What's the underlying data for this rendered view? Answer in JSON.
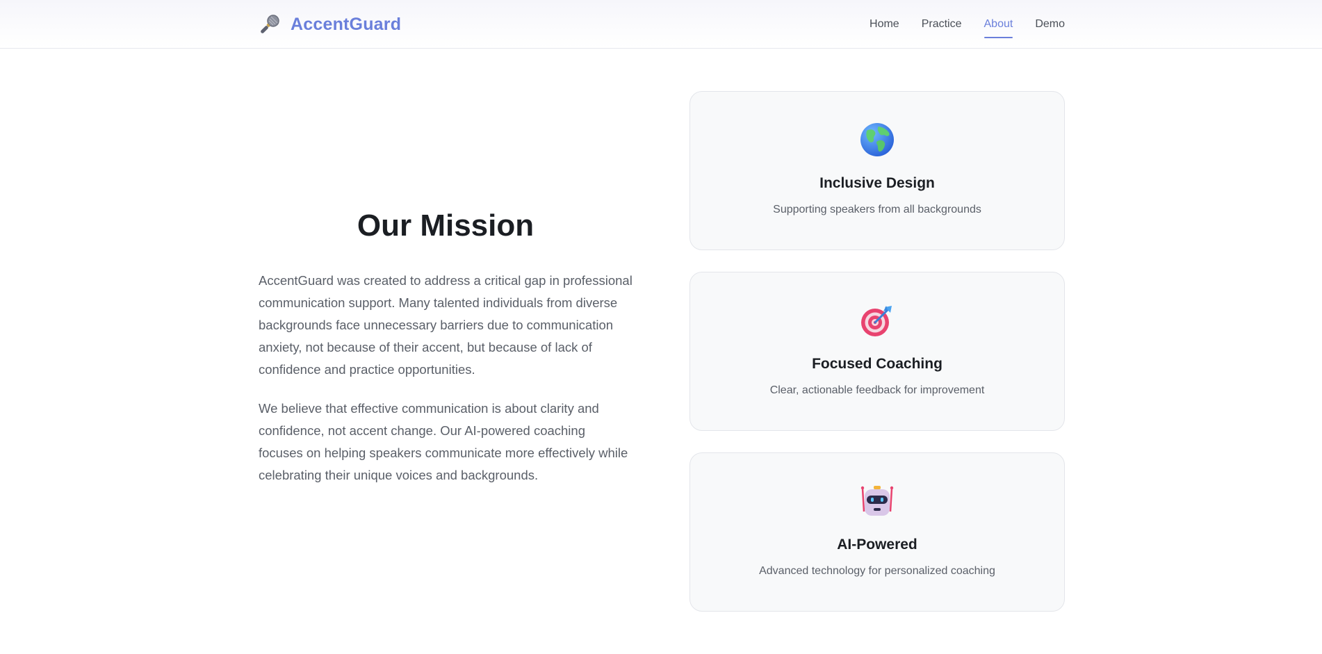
{
  "brand": {
    "name": "AccentGuard",
    "icon": "microphone-icon"
  },
  "nav": {
    "items": [
      {
        "label": "Home",
        "active": false
      },
      {
        "label": "Practice",
        "active": false
      },
      {
        "label": "About",
        "active": true
      },
      {
        "label": "Demo",
        "active": false
      }
    ]
  },
  "mission": {
    "title": "Our Mission",
    "paragraphs": [
      "AccentGuard was created to address a critical gap in professional communication support. Many talented individuals from diverse backgrounds face unnecessary barriers due to communication anxiety, not because of their accent, but because of lack of confidence and practice opportunities.",
      "We believe that effective communication is about clarity and confidence, not accent change. Our AI-powered coaching focuses on helping speakers communicate more effectively while celebrating their unique voices and backgrounds."
    ]
  },
  "cards": [
    {
      "icon": "globe-icon",
      "title": "Inclusive Design",
      "description": "Supporting speakers from all backgrounds"
    },
    {
      "icon": "target-icon",
      "title": "Focused Coaching",
      "description": "Clear, actionable feedback for improvement"
    },
    {
      "icon": "robot-icon",
      "title": "AI-Powered",
      "description": "Advanced technology for personalized coaching"
    }
  ],
  "colors": {
    "accent": "#6a7fdb",
    "card_bg": "#f8f9fa",
    "text_muted": "#5a5f68"
  }
}
